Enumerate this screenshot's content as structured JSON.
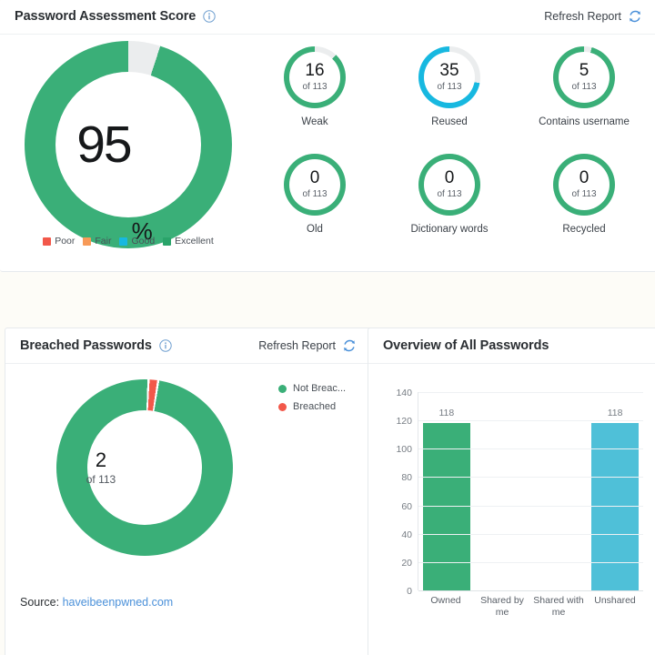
{
  "assessment": {
    "title": "Password Assessment Score",
    "info_icon": "info-icon",
    "refresh_label": "Refresh Report",
    "refresh_icon": "refresh-icon",
    "score": {
      "value": "95",
      "unit": "%",
      "percent": 95,
      "track_color": "#ebedee",
      "fill_color": "#3aaf78"
    },
    "legend": [
      {
        "label": "Poor",
        "color": "#f2584a"
      },
      {
        "label": "Fair",
        "color": "#f79a58"
      },
      {
        "label": "Good",
        "color": "#17b8e0"
      },
      {
        "label": "Excellent",
        "color": "#2aa46a"
      }
    ],
    "gauges": [
      {
        "value": "16",
        "of": "of 113",
        "label": "Weak",
        "percent": 88,
        "color": "#3aaf78"
      },
      {
        "value": "35",
        "of": "of 113",
        "label": "Reused",
        "percent": 72,
        "color": "#17b8e0"
      },
      {
        "value": "5",
        "of": "of 113",
        "label": "Contains username",
        "percent": 96,
        "color": "#3aaf78"
      },
      {
        "value": "0",
        "of": "of 113",
        "label": "Old",
        "percent": 100,
        "color": "#3aaf78"
      },
      {
        "value": "0",
        "of": "of 113",
        "label": "Dictionary words",
        "percent": 100,
        "color": "#3aaf78"
      },
      {
        "value": "0",
        "of": "of 113",
        "label": "Recycled",
        "percent": 100,
        "color": "#3aaf78"
      }
    ]
  },
  "breached": {
    "title": "Breached Passwords",
    "info_icon": "info-icon",
    "refresh_label": "Refresh Report",
    "refresh_icon": "refresh-icon",
    "center_value": "2",
    "center_of": "of 113",
    "legend": [
      {
        "label": "Not Breac...",
        "color": "#3aaf78"
      },
      {
        "label": "Breached",
        "color": "#f2584a"
      }
    ],
    "source_prefix": "Source:",
    "source_link": "haveibeenpwned.com",
    "chart_data": {
      "type": "pie",
      "title": "Breached Passwords",
      "labels": [
        "Not Breached",
        "Breached"
      ],
      "values": [
        111,
        2
      ],
      "total": 113,
      "colors": [
        "#3aaf78",
        "#f2584a"
      ],
      "legend_position": "right"
    }
  },
  "overview": {
    "title": "Overview of All Passwords",
    "chart_data": {
      "type": "bar",
      "title": "Overview of All Passwords",
      "categories": [
        "Owned",
        "Shared by me",
        "Shared with me",
        "Unshared"
      ],
      "values": [
        118,
        0,
        0,
        118
      ],
      "bar_colors": [
        "#3aaf78",
        "#3aaf78",
        "#3aaf78",
        "#4fc0d8"
      ],
      "data_labels": [
        "118",
        "",
        "",
        "118"
      ],
      "xlabel": "",
      "ylabel": "",
      "ylim": [
        0,
        140
      ],
      "yticks": [
        0,
        20,
        40,
        60,
        80,
        100,
        120,
        140
      ],
      "grid": true,
      "legend_position": "none"
    }
  },
  "colors": {
    "green": "#3aaf78",
    "cyan": "#17b8e0",
    "teal": "#4fc0d8",
    "red": "#f2584a",
    "orange": "#f79a58",
    "track": "#ebedee",
    "link": "#4a90d9",
    "page_bg": "#fdfcf7"
  }
}
